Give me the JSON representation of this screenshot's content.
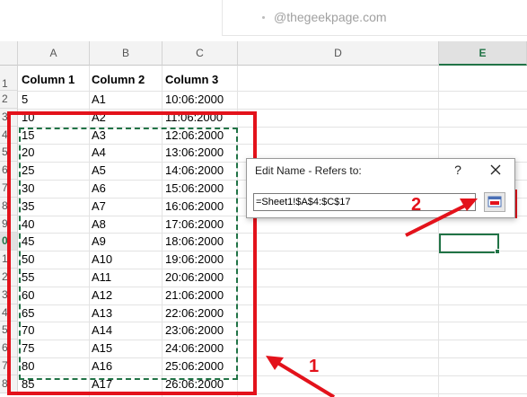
{
  "watermark": "@thegeekpage.com",
  "columns": [
    "A",
    "B",
    "C",
    "D",
    "E"
  ],
  "selected_column": "E",
  "row_labels": [
    "1",
    "2",
    "3",
    "4",
    "5",
    "6",
    "7",
    "8",
    "9",
    "0",
    "1",
    "2",
    "3",
    "4",
    "5",
    "6",
    "7",
    "8"
  ],
  "selected_row_label": "0",
  "headers": [
    "Column 1",
    "Column 2",
    "Column 3"
  ],
  "rows": [
    [
      "5",
      "A1",
      "10:06:2000"
    ],
    [
      "10",
      "A2",
      "11:06:2000"
    ],
    [
      "15",
      "A3",
      "12:06:2000"
    ],
    [
      "20",
      "A4",
      "13:06:2000"
    ],
    [
      "25",
      "A5",
      "14:06:2000"
    ],
    [
      "30",
      "A6",
      "15:06:2000"
    ],
    [
      "35",
      "A7",
      "16:06:2000"
    ],
    [
      "40",
      "A8",
      "17:06:2000"
    ],
    [
      "45",
      "A9",
      "18:06:2000"
    ],
    [
      "50",
      "A10",
      "19:06:2000"
    ],
    [
      "55",
      "A11",
      "20:06:2000"
    ],
    [
      "60",
      "A12",
      "21:06:2000"
    ],
    [
      "65",
      "A13",
      "22:06:2000"
    ],
    [
      "70",
      "A14",
      "23:06:2000"
    ],
    [
      "75",
      "A15",
      "24:06:2000"
    ],
    [
      "80",
      "A16",
      "25:06:2000"
    ],
    [
      "85",
      "A17",
      "26:06:2000"
    ]
  ],
  "dialog": {
    "title": "Edit Name - Refers to:",
    "help": "?",
    "close_icon": "close-icon",
    "refers_to_value": "=Sheet1!$A$4:$C$17",
    "collapse_icon": "collapse-dialog-icon"
  },
  "annotations": {
    "label_1": "1",
    "label_2": "2",
    "color": "#e3121b"
  },
  "accent_color": "#217346"
}
